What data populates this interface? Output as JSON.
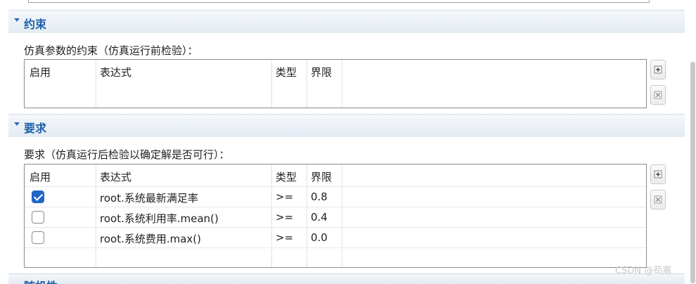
{
  "constraints": {
    "title": "约束",
    "caption": "仿真参数的约束（仿真运行前检验）：",
    "columns": [
      "启用",
      "表达式",
      "类型",
      "界限"
    ]
  },
  "requirements": {
    "title": "要求",
    "caption": "要求（仿真运行后检验以确定解是否可行）：",
    "columns": [
      "启用",
      "表达式",
      "类型",
      "界限"
    ],
    "rows": [
      {
        "enabled": true,
        "expression": "root.系统最新满足率",
        "type": ">=",
        "bound": "0.8"
      },
      {
        "enabled": false,
        "expression": "root.系统利用率.mean()",
        "type": ">=",
        "bound": "0.4"
      },
      {
        "enabled": false,
        "expression": "root.系统费用.max()",
        "type": ">=",
        "bound": "0.0"
      }
    ]
  },
  "next_section": {
    "title": "随机性"
  },
  "buttons": {
    "add_icon": "add-icon",
    "delete_icon": "delete-icon"
  },
  "watermark": "CSDN @苟离",
  "colors": {
    "header_text": "#1e5fa8",
    "checkbox_checked": "#2067c7"
  }
}
